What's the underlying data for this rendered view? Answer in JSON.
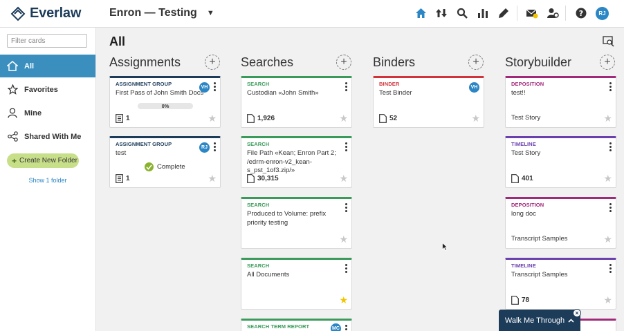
{
  "app": {
    "brand": "Everlaw",
    "project": "Enron — Testing"
  },
  "sidebar": {
    "filter_placeholder": "Filter cards",
    "items": [
      {
        "label": "All",
        "icon": "home-icon",
        "active": true
      },
      {
        "label": "Favorites",
        "icon": "star-icon",
        "active": false
      },
      {
        "label": "Mine",
        "icon": "person-icon",
        "active": false
      },
      {
        "label": "Shared With Me",
        "icon": "share-icon",
        "active": false
      }
    ],
    "create_folder": "Create New Folder",
    "show_folder": "Show 1 folder"
  },
  "main": {
    "title": "All"
  },
  "columns": [
    {
      "title": "Assignments"
    },
    {
      "title": "Searches"
    },
    {
      "title": "Binders"
    },
    {
      "title": "Storybuilder"
    }
  ],
  "cards": {
    "assign1": {
      "type": "ASSIGNMENT GROUP",
      "name": "First Pass of John Smith Docs",
      "avatar": "VH",
      "progress": "0%",
      "count": "1"
    },
    "assign2": {
      "type": "ASSIGNMENT GROUP",
      "name": "test",
      "avatar": "RJ",
      "status": "Complete",
      "count": "1"
    },
    "search1": {
      "type": "SEARCH",
      "name": "Custodian «John Smith»",
      "count": "1,926"
    },
    "search2": {
      "type": "SEARCH",
      "name": "File Path «Kean; Enron Part 2; /edrm-enron-v2_kean-s_pst_1of3.zip/»",
      "count": "30,315"
    },
    "search3": {
      "type": "SEARCH",
      "name": "Produced to Volume: prefix priority testing"
    },
    "search4": {
      "type": "SEARCH",
      "name": "All Documents",
      "favorite": true
    },
    "search5": {
      "type": "SEARCH TERM REPORT",
      "avatar": "MC"
    },
    "binder1": {
      "type": "BINDER",
      "name": "Test Binder",
      "avatar": "VH",
      "count": "52"
    },
    "story1": {
      "type": "DEPOSITION",
      "name": "test!!",
      "sub": "Test Story"
    },
    "story2": {
      "type": "TIMELINE",
      "name": "Test Story",
      "count": "401"
    },
    "story3": {
      "type": "DEPOSITION",
      "name": "long doc",
      "sub": "Transcript Samples"
    },
    "story4": {
      "type": "TIMELINE",
      "name": "Transcript Samples",
      "count": "78"
    }
  },
  "colors": {
    "assignment": "#1d3c5a",
    "search": "#3a9a5a",
    "binder": "#d0343a",
    "deposition": "#a0297a",
    "timeline": "#6a3fae",
    "accent": "#3a8fbf"
  },
  "user": {
    "initials": "RJ"
  },
  "walkme": {
    "label": "Walk Me Through"
  }
}
